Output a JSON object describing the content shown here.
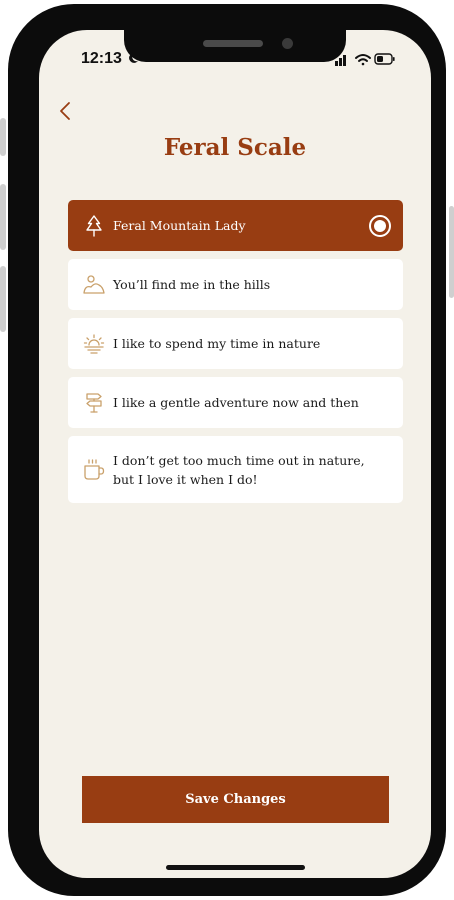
{
  "status_bar": {
    "time": "12:13"
  },
  "page": {
    "title": "Feral Scale"
  },
  "options": [
    {
      "label": "Feral Mountain Lady",
      "icon": "tree-icon",
      "selected": true
    },
    {
      "label": "You’ll find me in the hills",
      "icon": "hills-icon",
      "selected": false
    },
    {
      "label": "I like to spend my time in nature",
      "icon": "sunrise-icon",
      "selected": false
    },
    {
      "label": "I like a gentle adventure now and then",
      "icon": "signpost-icon",
      "selected": false
    },
    {
      "label_line1": "I don’t get too much time out in nature,",
      "label_line2": "but I love it when I do!",
      "icon": "coffee-mug-icon",
      "selected": false
    }
  ],
  "actions": {
    "save_label": "Save Changes"
  },
  "colors": {
    "accent": "#983d12",
    "background": "#f4f1e9",
    "icon_tan": "#c9a06a",
    "card": "#ffffff"
  }
}
